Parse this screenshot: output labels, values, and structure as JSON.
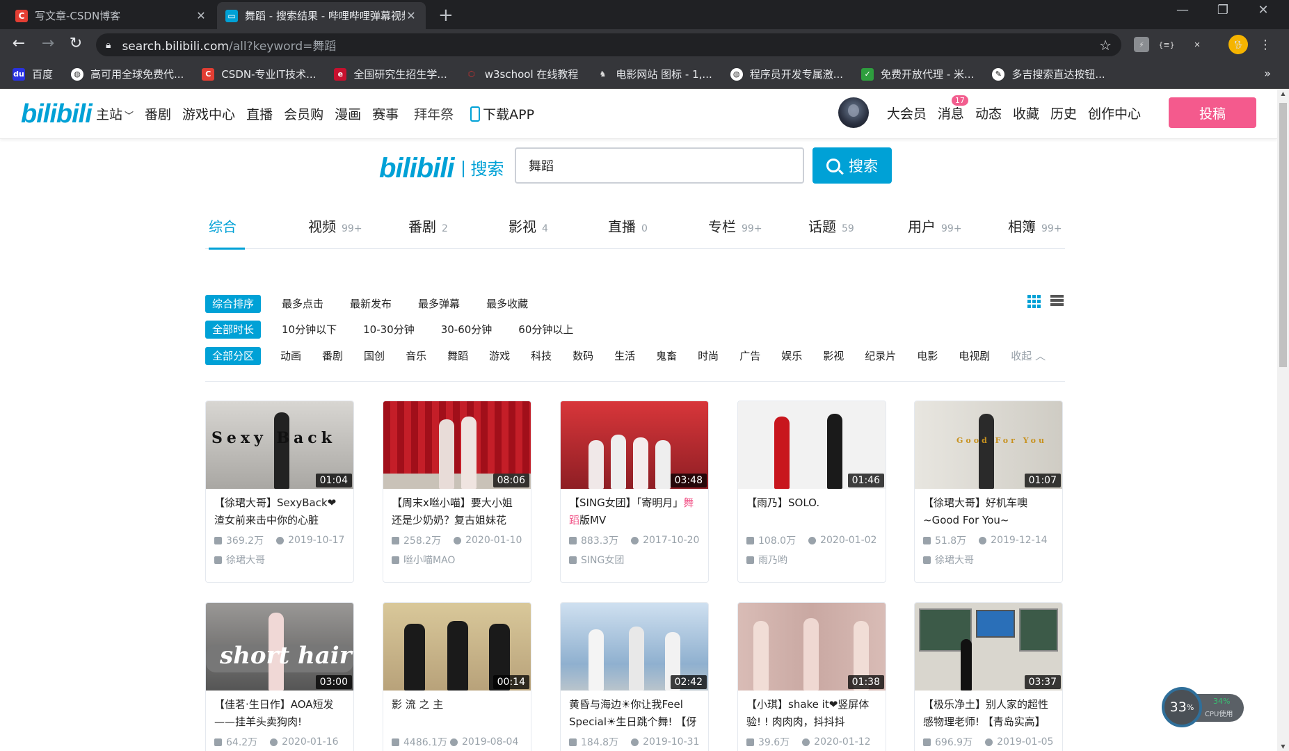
{
  "browser": {
    "tabs": [
      {
        "title": "写文章-CSDN博客",
        "favicon": "csdn-c",
        "color": "#e33e33",
        "active": false
      },
      {
        "title": "舞蹈 - 搜索结果 - 哔哩哔哩弹幕视频网",
        "favicon": "bilibili-tv",
        "color": "#00a1d6",
        "active": true
      }
    ],
    "url_host": "search.bilibili.com",
    "url_path": "/all?keyword=舞蹈",
    "bookmarks": [
      {
        "label": "百度",
        "color": "#2932e1",
        "icon": "du"
      },
      {
        "label": "高可用全球免费代...",
        "color": "#ffffff",
        "icon": "globe"
      },
      {
        "label": "CSDN-专业IT技术...",
        "color": "#e33e33",
        "icon": "C"
      },
      {
        "label": "全国研究生招生学...",
        "color": "#c8102e",
        "icon": "chsi"
      },
      {
        "label": "w3school 在线教程",
        "color": "#c8102e",
        "icon": "w3"
      },
      {
        "label": "电影网站 图标 - 1,...",
        "color": "#dddddd",
        "icon": "ic"
      },
      {
        "label": "程序员开发专属激...",
        "color": "#ffffff",
        "icon": "globe"
      },
      {
        "label": "免费开放代理 - 米...",
        "color": "#2e9e3e",
        "icon": "chk"
      },
      {
        "label": "多吉搜索直达按钮...",
        "color": "#ffffff",
        "icon": "dog"
      }
    ]
  },
  "header": {
    "logo": "bilibili",
    "nav": [
      "主站",
      "番剧",
      "游戏中心",
      "直播",
      "会员购",
      "漫画",
      "赛事",
      "拜年祭",
      "下载APP"
    ],
    "right": [
      "大会员",
      "消息",
      "动态",
      "收藏",
      "历史",
      "创作中心"
    ],
    "message_badge": "17",
    "upload": "投稿"
  },
  "search": {
    "logo_text": "bilibili",
    "logo_sub": "搜索",
    "query": "舞蹈",
    "button": "搜索"
  },
  "category_tabs": [
    {
      "label": "综合",
      "count": ""
    },
    {
      "label": "视频",
      "count": "99+"
    },
    {
      "label": "番剧",
      "count": "2"
    },
    {
      "label": "影视",
      "count": "4"
    },
    {
      "label": "直播",
      "count": "0"
    },
    {
      "label": "专栏",
      "count": "99+"
    },
    {
      "label": "话题",
      "count": "59"
    },
    {
      "label": "用户",
      "count": "99+"
    },
    {
      "label": "相簿",
      "count": "99+"
    }
  ],
  "filters": {
    "sort": [
      "综合排序",
      "最多点击",
      "最新发布",
      "最多弹幕",
      "最多收藏"
    ],
    "duration": [
      "全部时长",
      "10分钟以下",
      "10-30分钟",
      "30-60分钟",
      "60分钟以上"
    ],
    "zones": [
      "全部分区",
      "动画",
      "番剧",
      "国创",
      "音乐",
      "舞蹈",
      "游戏",
      "科技",
      "数码",
      "生活",
      "鬼畜",
      "时尚",
      "广告",
      "娱乐",
      "影视",
      "纪录片",
      "电影",
      "电视剧"
    ],
    "fold": "收起"
  },
  "videos": [
    {
      "title": "【徐珺大哥】SexyBack❤渣女前来击中你的心脏",
      "duration": "01:04",
      "views": "369.2万",
      "date": "2019-10-17",
      "up": "徐珺大哥",
      "overlay": "Sexy Back",
      "bg": "#b8b6b2"
    },
    {
      "title": "【周末x咝小喵】要大小姐还是少奶奶？复古姐妹花",
      "duration": "08:06",
      "views": "258.2万",
      "date": "2020-01-10",
      "up": "咝小喵MAO",
      "overlay": "",
      "bg": "#b0141e"
    },
    {
      "title_pre": "【SING女团】「寄明月」",
      "title_hl": "舞蹈",
      "title_post": "版MV",
      "duration": "03:48",
      "views": "883.3万",
      "date": "2017-10-20",
      "up": "SING女团",
      "overlay": "",
      "bg": "#d63838"
    },
    {
      "title": "【雨乃】SOLO.",
      "duration": "01:46",
      "views": "108.0万",
      "date": "2020-01-02",
      "up": "雨乃哟",
      "overlay": "",
      "bg": "#ececec"
    },
    {
      "title": "【徐珺大哥】好机车噢~Good For You~",
      "duration": "01:07",
      "views": "51.8万",
      "date": "2019-12-14",
      "up": "徐珺大哥",
      "overlay": "Good For You",
      "bg": "#d8d6d0"
    },
    {
      "title": "【佳茗·生日作】AOA短发——挂羊头卖狗肉!",
      "duration": "03:00",
      "views": "64.2万",
      "date": "2020-01-16",
      "up": "",
      "overlay": "short hair",
      "bg": "#8a8a8a"
    },
    {
      "title": "影 流 之 主",
      "duration": "00:14",
      "views": "4486.1万",
      "date": "2019-08-04",
      "up": "",
      "overlay": "",
      "bg": "#c8b89a"
    },
    {
      "title": "黄昏与海边☀你让我Feel Special☀生日跳个舞! 【伢",
      "duration": "02:42",
      "views": "184.8万",
      "date": "2019-10-31",
      "up": "",
      "overlay": "",
      "bg": "#a9c4e0"
    },
    {
      "title": "【小琪】shake it❤竖屏体验! ! 肉肉肉，抖抖抖",
      "duration": "01:38",
      "views": "39.6万",
      "date": "2020-01-12",
      "up": "",
      "overlay": "",
      "bg": "#c9a6a0"
    },
    {
      "title": "【极乐净土】别人家的超性感物理老师! 【青岛实高】",
      "duration": "03:37",
      "views": "696.9万",
      "date": "2019-01-05",
      "up": "",
      "overlay": "",
      "bg": "#6e8a76"
    }
  ],
  "cpu_widget": {
    "percent": "33",
    "unit": "%",
    "small_percent": "34%",
    "label": "CPU使用"
  }
}
